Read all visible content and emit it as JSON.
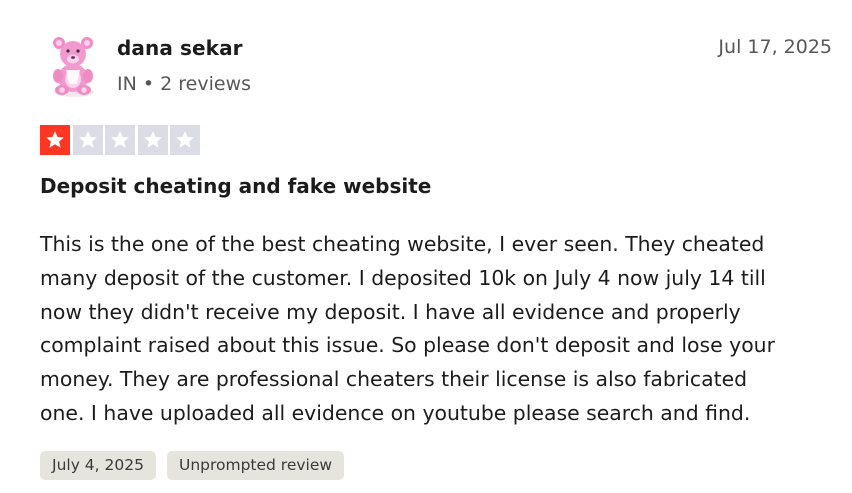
{
  "reviewer": {
    "name": "dana sekar",
    "country": "IN",
    "separator": "•",
    "review_count": "2 reviews",
    "avatar_icon": "pink-teddy-bear-avatar"
  },
  "review": {
    "date": "Jul 17, 2025",
    "rating": 1,
    "rating_max": 5,
    "star_colors": {
      "filled": "#ff3722",
      "empty": "#dcdce6"
    },
    "title": "Deposit cheating and fake website",
    "body_lines": [
      "This is the one of the best cheating website, I ever seen. They cheated",
      "many deposit of the customer. I deposited 10k on July 4 now july 14 till",
      "now they didn't receive my deposit. I have all evidence and properly",
      "complaint raised about this issue. So please don't deposit and lose your",
      "money. They are professional cheaters their license is also fabricated",
      "one. I have uploaded all evidence on youtube please search and find."
    ],
    "experience_date": "July 4, 2025",
    "tag": "Unprompted review"
  }
}
